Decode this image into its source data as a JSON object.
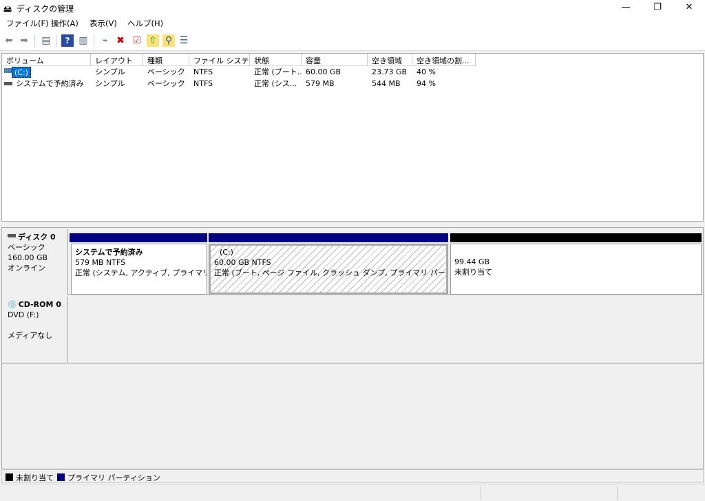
{
  "window": {
    "title": "ディスクの管理",
    "minimize": "—",
    "restore": "❐",
    "close": "✕"
  },
  "menu": [
    "ファイル(F)",
    "操作(A)",
    "表示(V)",
    "ヘルプ(H)"
  ],
  "toolbar": {
    "icons": [
      "back-icon",
      "forward-icon",
      "console-tree-icon",
      "help-icon",
      "action-pane-icon",
      "connect-drive-icon",
      "delete-icon",
      "properties-icon",
      "open-icon",
      "explore-icon",
      "settings-list-icon"
    ]
  },
  "volume_list": {
    "columns": [
      "ボリューム",
      "レイアウト",
      "種類",
      "ファイル システム",
      "状態",
      "容量",
      "空き領域",
      "空き領域の割..."
    ],
    "rows": [
      [
        "(C:)",
        "シンプル",
        "ベーシック",
        "NTFS",
        "正常 (ブート...",
        "60.00 GB",
        "23.73 GB",
        "40 %"
      ],
      [
        "システムで予約済み",
        "シンプル",
        "ベーシック",
        "NTFS",
        "正常 (シス...",
        "579 MB",
        "544 MB",
        "94 %"
      ]
    ]
  },
  "disks": [
    {
      "name": "ディスク 0",
      "type": "ベーシック",
      "size": "160.00 GB",
      "status": "オンライン",
      "partitions": [
        {
          "name": "システムで予約済み",
          "size": "579 MB NTFS",
          "status": "正常 (システム, アクティブ, プライマリ パー"
        },
        {
          "name": "(C:)",
          "size": "60.00 GB NTFS",
          "status": "正常 (ブート, ページ ファイル, クラッシュ ダンプ, プライマリ パーティション)"
        },
        {
          "size": "99.44 GB",
          "status": "未割り当て"
        }
      ]
    },
    {
      "name": "CD-ROM 0",
      "type": "DVD (F:)",
      "status": "メディアなし"
    }
  ],
  "legend": [
    {
      "label": "未割り当て",
      "color": "#000000"
    },
    {
      "label": "プライマリ パーティション",
      "color": "#000080"
    }
  ]
}
